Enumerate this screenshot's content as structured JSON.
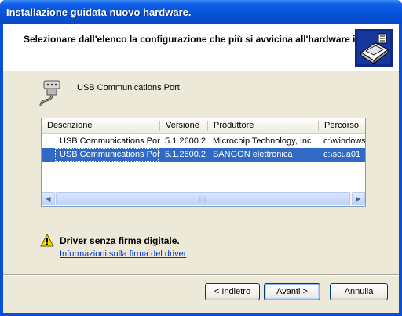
{
  "window": {
    "title": "Installazione guidata nuovo hardware."
  },
  "header": {
    "instruction": "Selezionare dall'elenco la configurazione che più si avvicina all'hardware in uso."
  },
  "device": {
    "name": "USB Communications Port",
    "icon": "serial-port-icon"
  },
  "table": {
    "columns": [
      "Descrizione",
      "Versione",
      "Produttore",
      "Percorso"
    ],
    "rows": [
      {
        "description": "USB Communications Port",
        "version": "5.1.2600.2",
        "manufacturer": "Microchip Technology, Inc.",
        "path": "c:\\windows",
        "selected": false
      },
      {
        "description": "USB Communications Port",
        "version": "5.1.2600.2",
        "manufacturer": "SANGON elettronica",
        "path": "c:\\scua01",
        "selected": true
      }
    ]
  },
  "warning": {
    "icon": "warning-icon",
    "title": "Driver senza firma digitale.",
    "link": "Informazioni sulla firma del driver"
  },
  "buttons": {
    "back": "< Indietro",
    "next": "Avanti >",
    "cancel": "Annulla"
  },
  "colors": {
    "selection": "#316ac5",
    "titlebar": "#0552d8",
    "dialog": "#ece9d8",
    "link": "#0033cc"
  }
}
